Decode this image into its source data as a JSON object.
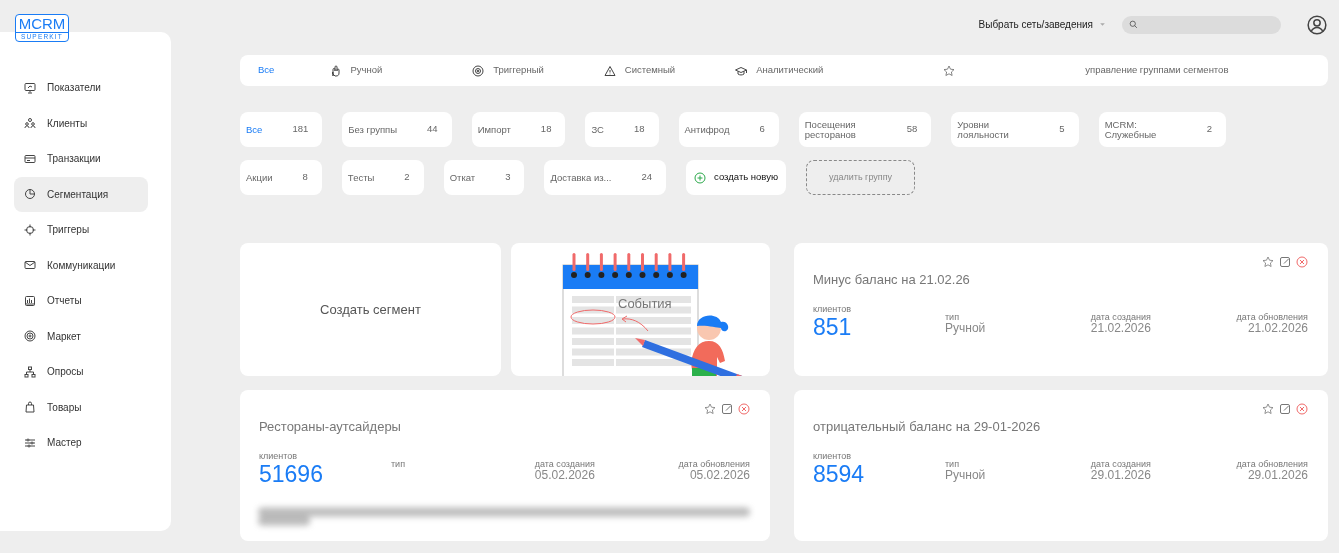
{
  "logo": {
    "title": "MCRM",
    "subtitle": "SUPERKIT"
  },
  "header": {
    "network_select": "Выбрать сеть/заведения"
  },
  "sidebar": {
    "items": [
      {
        "label": "Показатели",
        "selected": false
      },
      {
        "label": "Клиенты",
        "selected": false
      },
      {
        "label": "Транзакции",
        "selected": false
      },
      {
        "label": "Сегментация",
        "selected": true
      },
      {
        "label": "Триггеры",
        "selected": false
      },
      {
        "label": "Коммуникации",
        "selected": false
      },
      {
        "label": "Отчеты",
        "selected": false
      },
      {
        "label": "Маркет",
        "selected": false
      },
      {
        "label": "Опросы",
        "selected": false
      },
      {
        "label": "Товары",
        "selected": false
      },
      {
        "label": "Мастер",
        "selected": false
      }
    ]
  },
  "type_tabs": [
    {
      "label": "Все",
      "selected": true
    },
    {
      "label": "Ручной",
      "selected": false
    },
    {
      "label": "Триггерный",
      "selected": false
    },
    {
      "label": "Системный",
      "selected": false
    },
    {
      "label": "Аналитический",
      "selected": false
    }
  ],
  "manage_groups": "управление группами сегментов",
  "groups": [
    {
      "label": "Все",
      "count": "181",
      "selected": true
    },
    {
      "label": "Без группы",
      "count": "44",
      "selected": false
    },
    {
      "label": "Импорт",
      "count": "18",
      "selected": false
    },
    {
      "label": "ЗС",
      "count": "18",
      "selected": false
    },
    {
      "label": "Антифрод",
      "count": "6",
      "selected": false
    },
    {
      "label": "Посещения ресторанов",
      "count": "58",
      "selected": false
    },
    {
      "label": "Уровни лояльности",
      "count": "5",
      "selected": false
    },
    {
      "label": "MCRM: Служебные",
      "count": "2",
      "selected": false
    },
    {
      "label": "Акции",
      "count": "8",
      "selected": false
    },
    {
      "label": "Тесты",
      "count": "2",
      "selected": false
    },
    {
      "label": "Откат",
      "count": "3",
      "selected": false
    },
    {
      "label": "Доставка из...",
      "count": "24",
      "selected": false
    }
  ],
  "create_group": "создать новую",
  "delete_group": "удалить группу",
  "create_segment": "Создать сегмент",
  "events_card": {
    "label": "События"
  },
  "segments": [
    {
      "title": "Минус баланс на 21.02.26",
      "clients_label": "клиентов",
      "clients": "851",
      "type_label": "тип",
      "type": "Ручной",
      "created_label": "дата создания",
      "created": "21.02.2026",
      "updated_label": "дата обновления",
      "updated": "21.02.2026",
      "blurred_note": false
    },
    {
      "title": "Рестораны-аутсайдеры",
      "clients_label": "клиентов",
      "clients": "51696",
      "type_label": "тип",
      "created_label": "дата создания",
      "created": "05.02.2026",
      "updated_label": "дата обновления",
      "updated": "05.02.2026",
      "blurred_note": true
    },
    {
      "title": "отрицательный баланс на 29-01-2026",
      "clients_label": "клиентов",
      "clients": "8594",
      "type_label": "тип",
      "type": "Ручной",
      "created_label": "дата создания",
      "created": "29.01.2026",
      "updated_label": "дата обновления",
      "updated": "29.01.2026",
      "blurred_note": false
    }
  ]
}
